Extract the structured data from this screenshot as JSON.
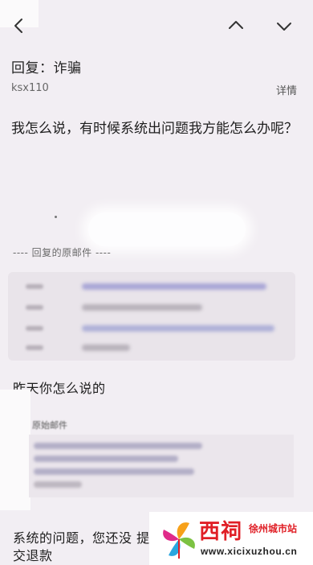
{
  "nav": {
    "back_icon": "chevron-left-icon",
    "prev_icon": "chevron-up-icon",
    "next_icon": "chevron-down-icon"
  },
  "email": {
    "subject": "回复：诈骗",
    "sender": "ksx110",
    "details_label": "详情",
    "body": "我怎么说，有时候系统出问题我方能怎么办呢？"
  },
  "quoted": {
    "divider": "---- 回复的原邮件 ----",
    "reply_text": "昨天你怎么说的",
    "orig_label": "原始邮件"
  },
  "footer": {
    "text": "系统的问题，您还没 提交退款"
  },
  "watermark": {
    "title": "西祠",
    "city": "徐州城市站",
    "url": "www.xicixuzhou.cn"
  },
  "colors": {
    "background": "#f2eef3",
    "watermark_red": "#e01f26"
  }
}
